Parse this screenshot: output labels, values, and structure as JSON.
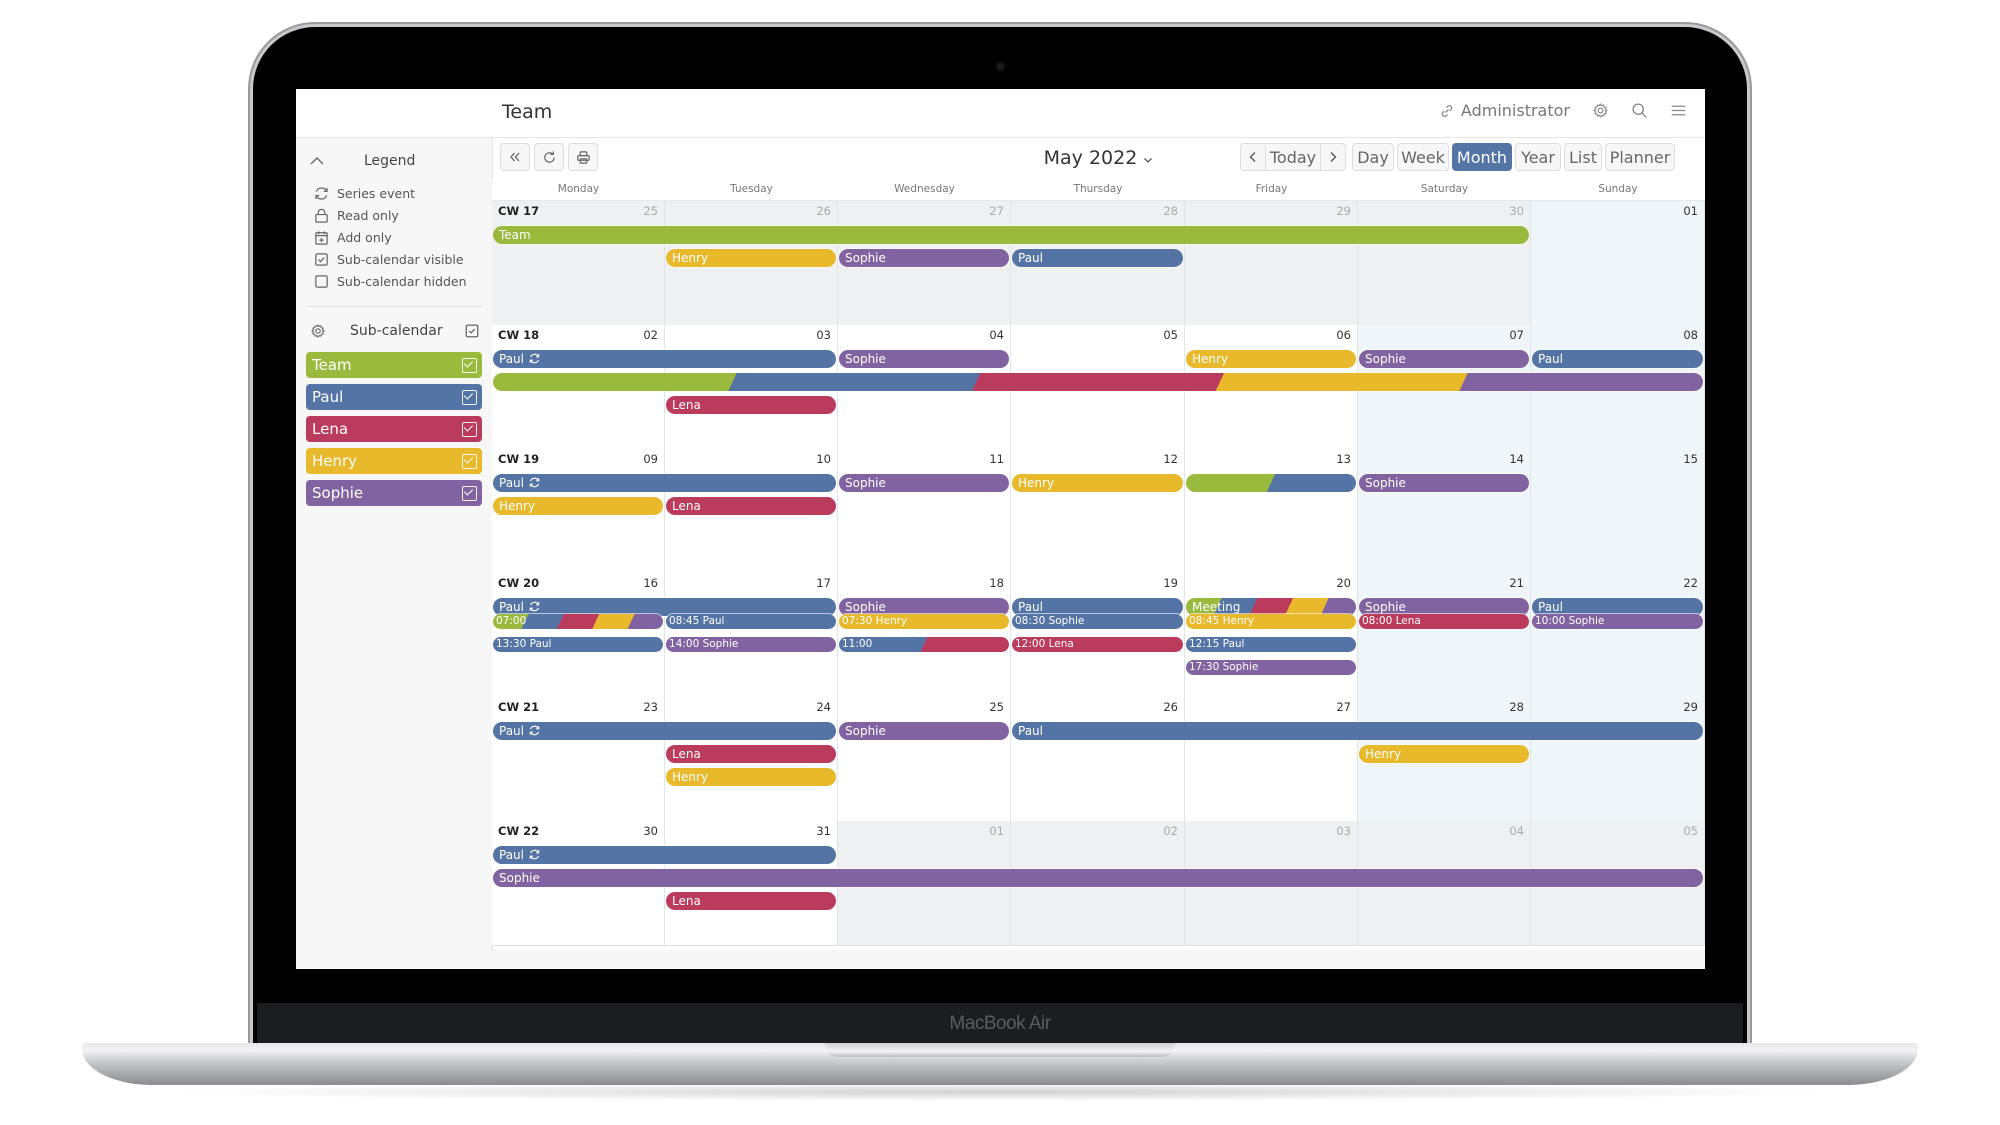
{
  "device": {
    "label": "MacBook Air"
  },
  "header": {
    "title": "Team",
    "user_label": "Administrator",
    "icons": [
      "link-icon",
      "gear-icon",
      "search-icon",
      "menu-icon"
    ]
  },
  "sidebar": {
    "legend_title": "Legend",
    "legend_items": [
      {
        "icon": "series-icon",
        "label": "Series event"
      },
      {
        "icon": "lock-icon",
        "label": "Read only"
      },
      {
        "icon": "calendar-add-icon",
        "label": "Add only"
      },
      {
        "icon": "checkbox-checked-icon",
        "label": "Sub-calendar visible"
      },
      {
        "icon": "checkbox-empty-icon",
        "label": "Sub-calendar hidden"
      }
    ],
    "subcalendar_title": "Sub-calendar",
    "subcalendars": [
      {
        "label": "Team",
        "color": "#9aba3d",
        "checked": true
      },
      {
        "label": "Paul",
        "color": "#5474a6",
        "checked": true
      },
      {
        "label": "Lena",
        "color": "#bb3b5c",
        "checked": true
      },
      {
        "label": "Henry",
        "color": "#e9b92c",
        "checked": true
      },
      {
        "label": "Sophie",
        "color": "#8063a0",
        "checked": true
      }
    ]
  },
  "toolbar": {
    "month_label": "May 2022",
    "today_label": "Today",
    "views": [
      "Day",
      "Week",
      "Month",
      "Year",
      "List",
      "Planner"
    ],
    "active_view": "Month"
  },
  "colors": {
    "Team": "#9aba3d",
    "Paul": "#5474a6",
    "Lena": "#bb3b5c",
    "Henry": "#e9b92c",
    "Sophie": "#8063a0"
  },
  "calendar": {
    "day_names": [
      "Monday",
      "Tuesday",
      "Wednesday",
      "Thursday",
      "Friday",
      "Saturday",
      "Sunday"
    ],
    "weeks": [
      {
        "cw": "CW 17",
        "days": [
          "25",
          "26",
          "27",
          "28",
          "29",
          "30",
          "01"
        ],
        "outside": [
          true,
          true,
          true,
          true,
          true,
          true,
          false
        ],
        "events": [
          {
            "label": "Team",
            "start": 0,
            "span": 6,
            "lane": 0,
            "colors": [
              "Team"
            ]
          },
          {
            "label": "Henry",
            "start": 1,
            "span": 1,
            "lane": 1,
            "colors": [
              "Henry"
            ]
          },
          {
            "label": "Sophie",
            "start": 2,
            "span": 1,
            "lane": 1,
            "colors": [
              "Sophie"
            ]
          },
          {
            "label": "Paul",
            "start": 3,
            "span": 1,
            "lane": 1,
            "colors": [
              "Paul"
            ]
          }
        ]
      },
      {
        "cw": "CW 18",
        "days": [
          "02",
          "03",
          "04",
          "05",
          "06",
          "07",
          "08"
        ],
        "outside": [
          false,
          false,
          false,
          false,
          false,
          false,
          false
        ],
        "events": [
          {
            "label": "Paul",
            "series": true,
            "start": 0,
            "span": 2,
            "lane": 0,
            "colors": [
              "Paul"
            ]
          },
          {
            "label": "Sophie",
            "start": 2,
            "span": 1,
            "lane": 0,
            "colors": [
              "Sophie"
            ]
          },
          {
            "label": "Henry",
            "start": 4,
            "span": 1,
            "lane": 0,
            "colors": [
              "Henry"
            ]
          },
          {
            "label": "Sophie",
            "start": 5,
            "span": 1,
            "lane": 0,
            "colors": [
              "Sophie"
            ]
          },
          {
            "label": "Paul",
            "start": 6,
            "span": 1,
            "lane": 0,
            "colors": [
              "Paul"
            ]
          },
          {
            "label": "",
            "start": 0,
            "span": 7,
            "lane": 1,
            "colors": [
              "Team",
              "Paul",
              "Lena",
              "Henry",
              "Sophie"
            ]
          },
          {
            "label": "Lena",
            "start": 1,
            "span": 1,
            "lane": 2,
            "colors": [
              "Lena"
            ]
          }
        ]
      },
      {
        "cw": "CW 19",
        "days": [
          "09",
          "10",
          "11",
          "12",
          "13",
          "14",
          "15"
        ],
        "outside": [
          false,
          false,
          false,
          false,
          false,
          false,
          false
        ],
        "events": [
          {
            "label": "Paul",
            "series": true,
            "start": 0,
            "span": 2,
            "lane": 0,
            "colors": [
              "Paul"
            ]
          },
          {
            "label": "Sophie",
            "start": 2,
            "span": 1,
            "lane": 0,
            "colors": [
              "Sophie"
            ]
          },
          {
            "label": "Henry",
            "start": 3,
            "span": 1,
            "lane": 0,
            "colors": [
              "Henry"
            ]
          },
          {
            "label": "",
            "start": 4,
            "span": 1,
            "lane": 0,
            "colors": [
              "Team",
              "Paul"
            ]
          },
          {
            "label": "Sophie",
            "start": 5,
            "span": 1,
            "lane": 0,
            "colors": [
              "Sophie"
            ]
          },
          {
            "label": "Henry",
            "start": 0,
            "span": 1,
            "lane": 1,
            "colors": [
              "Henry"
            ]
          },
          {
            "label": "Lena",
            "start": 1,
            "span": 1,
            "lane": 1,
            "colors": [
              "Lena"
            ]
          }
        ]
      },
      {
        "cw": "CW 20",
        "days": [
          "16",
          "17",
          "18",
          "19",
          "20",
          "21",
          "22"
        ],
        "outside": [
          false,
          false,
          false,
          false,
          false,
          false,
          false
        ],
        "events": [
          {
            "label": "Paul",
            "series": true,
            "start": 0,
            "span": 2,
            "lane": 0,
            "colors": [
              "Paul"
            ]
          },
          {
            "label": "Sophie",
            "start": 2,
            "span": 1,
            "lane": 0,
            "colors": [
              "Sophie"
            ]
          },
          {
            "label": "Paul",
            "start": 3,
            "span": 1,
            "lane": 0,
            "colors": [
              "Paul"
            ]
          },
          {
            "label": "Meeting",
            "start": 4,
            "span": 1,
            "lane": 0,
            "colors": [
              "Team",
              "Paul",
              "Lena",
              "Henry",
              "Sophie"
            ]
          },
          {
            "label": "Sophie",
            "start": 5,
            "span": 1,
            "lane": 0,
            "colors": [
              "Sophie"
            ]
          },
          {
            "label": "Paul",
            "start": 6,
            "span": 1,
            "lane": 0,
            "colors": [
              "Paul"
            ]
          },
          {
            "label": "07:00",
            "small": true,
            "start": 0,
            "span": 1,
            "lane": 1,
            "colors": [
              "Team",
              "Paul",
              "Lena",
              "Henry",
              "Sophie"
            ]
          },
          {
            "label": "08:45 Paul",
            "small": true,
            "start": 1,
            "span": 1,
            "lane": 1,
            "colors": [
              "Paul"
            ]
          },
          {
            "label": "07:30 Henry",
            "small": true,
            "start": 2,
            "span": 1,
            "lane": 1,
            "colors": [
              "Henry"
            ]
          },
          {
            "label": "08:30 Sophie",
            "small": true,
            "start": 3,
            "span": 1,
            "lane": 1,
            "colors": [
              "Paul"
            ]
          },
          {
            "label": "08:45 Henry",
            "small": true,
            "start": 4,
            "span": 1,
            "lane": 1,
            "colors": [
              "Henry"
            ]
          },
          {
            "label": "08:00 Lena",
            "small": true,
            "start": 5,
            "span": 1,
            "lane": 1,
            "colors": [
              "Lena"
            ]
          },
          {
            "label": "10:00 Sophie",
            "small": true,
            "start": 6,
            "span": 1,
            "lane": 1,
            "colors": [
              "Sophie"
            ]
          },
          {
            "label": "13:30 Paul",
            "small": true,
            "start": 0,
            "span": 1,
            "lane": 2,
            "colors": [
              "Paul"
            ]
          },
          {
            "label": "14:00 Sophie",
            "small": true,
            "start": 1,
            "span": 1,
            "lane": 2,
            "colors": [
              "Sophie"
            ]
          },
          {
            "label": "11:00",
            "small": true,
            "start": 2,
            "span": 1,
            "lane": 2,
            "colors": [
              "Paul",
              "Lena"
            ]
          },
          {
            "label": "12:00 Lena",
            "small": true,
            "start": 3,
            "span": 1,
            "lane": 2,
            "colors": [
              "Lena"
            ]
          },
          {
            "label": "12:15 Paul",
            "small": true,
            "start": 4,
            "span": 1,
            "lane": 2,
            "colors": [
              "Paul"
            ]
          },
          {
            "label": "17:30 Sophie",
            "small": true,
            "start": 4,
            "span": 1,
            "lane": 3,
            "colors": [
              "Sophie"
            ]
          }
        ]
      },
      {
        "cw": "CW 21",
        "days": [
          "23",
          "24",
          "25",
          "26",
          "27",
          "28",
          "29"
        ],
        "outside": [
          false,
          false,
          false,
          false,
          false,
          false,
          false
        ],
        "events": [
          {
            "label": "Paul",
            "series": true,
            "start": 0,
            "span": 2,
            "lane": 0,
            "colors": [
              "Paul"
            ]
          },
          {
            "label": "Sophie",
            "start": 2,
            "span": 1,
            "lane": 0,
            "colors": [
              "Sophie"
            ]
          },
          {
            "label": "Paul",
            "start": 3,
            "span": 4,
            "lane": 0,
            "colors": [
              "Paul"
            ]
          },
          {
            "label": "Lena",
            "start": 1,
            "span": 1,
            "lane": 1,
            "colors": [
              "Lena"
            ]
          },
          {
            "label": "Henry",
            "start": 5,
            "span": 1,
            "lane": 1,
            "colors": [
              "Henry"
            ]
          },
          {
            "label": "Henry",
            "start": 1,
            "span": 1,
            "lane": 2,
            "colors": [
              "Henry"
            ]
          }
        ]
      },
      {
        "cw": "CW 22",
        "days": [
          "30",
          "31",
          "01",
          "02",
          "03",
          "04",
          "05"
        ],
        "outside": [
          false,
          false,
          true,
          true,
          true,
          true,
          true
        ],
        "events": [
          {
            "label": "Paul",
            "series": true,
            "start": 0,
            "span": 2,
            "lane": 0,
            "colors": [
              "Paul"
            ]
          },
          {
            "label": "Sophie",
            "start": 0,
            "span": 7,
            "lane": 1,
            "colors": [
              "Sophie"
            ]
          },
          {
            "label": "Lena",
            "start": 1,
            "span": 1,
            "lane": 2,
            "colors": [
              "Lena"
            ]
          }
        ]
      }
    ]
  }
}
